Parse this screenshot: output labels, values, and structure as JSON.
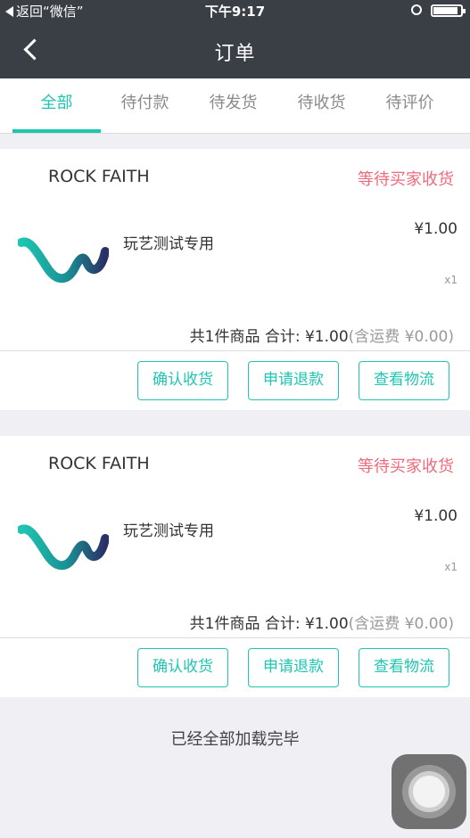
{
  "status_bar": {
    "back_app": "返回“微信”",
    "time": "下午9:17"
  },
  "nav": {
    "title": "订单",
    "back_icon": "chevron-left-icon"
  },
  "tabs": [
    {
      "label": "全部",
      "active": true
    },
    {
      "label": "待付款",
      "active": false
    },
    {
      "label": "待发货",
      "active": false
    },
    {
      "label": "待收货",
      "active": false
    },
    {
      "label": "待评价",
      "active": false
    }
  ],
  "orders": [
    {
      "shop": "ROCK FAITH",
      "status": "等待买家收货",
      "product_name": "玩艺测试专用",
      "price": "¥1.00",
      "qty": "x1",
      "summary": "共1件商品 合计: ¥1.00",
      "shipping": "(含运费 ¥0.00)",
      "buttons": {
        "confirm": "确认收货",
        "refund": "申请退款",
        "logistics": "查看物流"
      }
    },
    {
      "shop": "ROCK FAITH",
      "status": "等待买家收货",
      "product_name": "玩艺测试专用",
      "price": "¥1.00",
      "qty": "x1",
      "summary": "共1件商品 合计: ¥1.00",
      "shipping": "(含运费 ¥0.00)",
      "buttons": {
        "confirm": "确认收货",
        "refund": "申请退款",
        "logistics": "查看物流"
      }
    }
  ],
  "footer": {
    "loaded_all": "已经全部加载完毕"
  },
  "colors": {
    "accent": "#1ec6b1",
    "status_pink": "#ef6a7b",
    "header_bg": "#3a3f46"
  }
}
